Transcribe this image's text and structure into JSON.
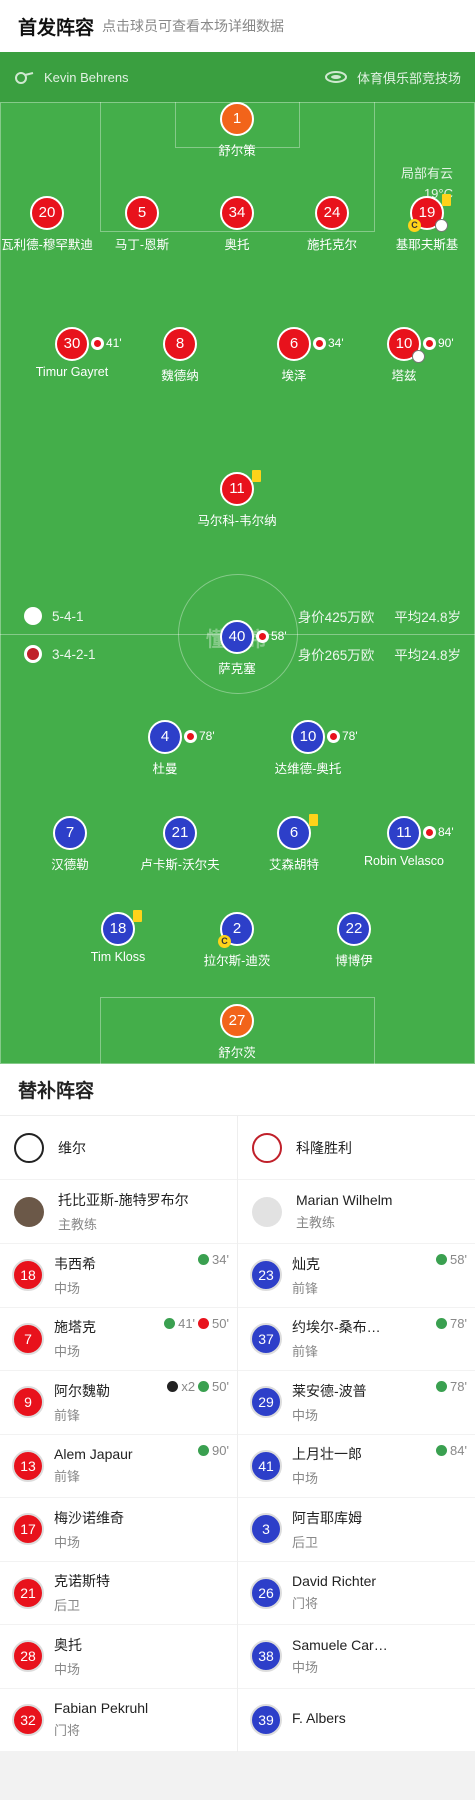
{
  "header": {
    "title": "首发阵容",
    "hint": "点击球员可查看本场详细数据"
  },
  "match": {
    "referee": "Kevin Behrens",
    "venue": "体育俱乐部竞技场",
    "weather": "局部有云",
    "temperature": "19°C",
    "watermark": "懂球帝"
  },
  "home_team": {
    "formation": "5-4-1",
    "value": "身价425万欧",
    "age": "平均24.8岁"
  },
  "away_team": {
    "formation": "3-4-2-1",
    "value": "身价265万欧",
    "age": "平均24.8岁"
  },
  "home_players": [
    {
      "num": "1",
      "name": "舒尔策",
      "gk": true
    },
    {
      "num": "20",
      "name": "瓦利德-穆罕默迪"
    },
    {
      "num": "5",
      "name": "马丁-恩斯"
    },
    {
      "num": "34",
      "name": "奥托"
    },
    {
      "num": "24",
      "name": "施托克尔"
    },
    {
      "num": "19",
      "name": "基耶夫斯基",
      "yellow": true,
      "captain": true,
      "goal": true
    },
    {
      "num": "30",
      "name": "Timur Gayret",
      "sub": "41'"
    },
    {
      "num": "8",
      "name": "魏德纳"
    },
    {
      "num": "6",
      "name": "埃泽",
      "sub": "34'"
    },
    {
      "num": "10",
      "name": "塔兹",
      "sub": "90'",
      "goal": true
    },
    {
      "num": "11",
      "name": "马尔科-韦尔纳",
      "yellow": true
    }
  ],
  "away_players": [
    {
      "num": "40",
      "name": "萨克塞",
      "sub": "58'"
    },
    {
      "num": "4",
      "name": "杜曼",
      "sub": "78'"
    },
    {
      "num": "10",
      "name": "达维德-奥托",
      "sub": "78'"
    },
    {
      "num": "7",
      "name": "汉德勒"
    },
    {
      "num": "21",
      "name": "卢卡斯-沃尔夫"
    },
    {
      "num": "6",
      "name": "艾森胡特",
      "yellow": true
    },
    {
      "num": "11",
      "name": "Robin Velasco",
      "sub": "84'"
    },
    {
      "num": "18",
      "name": "Tim Kloss",
      "yellow": true
    },
    {
      "num": "2",
      "name": "拉尔斯-迪茨",
      "captain": true
    },
    {
      "num": "22",
      "name": "博博伊"
    },
    {
      "num": "27",
      "name": "舒尔茨",
      "gk": true
    }
  ],
  "subs": {
    "title": "替补阵容",
    "home": {
      "team_name": "维尔",
      "coach_name": "托比亚斯-施特罗布尔",
      "coach_role": "主教练",
      "players": [
        {
          "num": "18",
          "name": "韦西希",
          "pos": "中场",
          "ev": "34'"
        },
        {
          "num": "7",
          "name": "施塔克",
          "pos": "中场",
          "ev": "41'",
          "ev2": "50'"
        },
        {
          "num": "9",
          "name": "阿尔魏勒",
          "pos": "前锋",
          "ev": "x2",
          "ev2": "50'"
        },
        {
          "num": "13",
          "name": "Alem Japaur",
          "pos": "前锋",
          "ev": "90'"
        },
        {
          "num": "17",
          "name": "梅沙诺维奇",
          "pos": "中场"
        },
        {
          "num": "21",
          "name": "克诺斯特",
          "pos": "后卫"
        },
        {
          "num": "28",
          "name": "奥托",
          "pos": "中场"
        },
        {
          "num": "32",
          "name": "Fabian Pekruhl",
          "pos": "门将"
        }
      ]
    },
    "away": {
      "team_name": "科隆胜利",
      "coach_name": "Marian Wilhelm",
      "coach_role": "主教练",
      "players": [
        {
          "num": "23",
          "name": "灿克",
          "pos": "前锋",
          "ev": "58'"
        },
        {
          "num": "37",
          "name": "约埃尔-桑布…",
          "pos": "前锋",
          "ev": "78'"
        },
        {
          "num": "29",
          "name": "莱安德-波普",
          "pos": "中场",
          "ev": "78'"
        },
        {
          "num": "41",
          "name": "上月壮一郎",
          "pos": "中场",
          "ev": "84'"
        },
        {
          "num": "3",
          "name": "阿吉耶库姆",
          "pos": "后卫"
        },
        {
          "num": "26",
          "name": "David Richter",
          "pos": "门将"
        },
        {
          "num": "38",
          "name": "Samuele Car…",
          "pos": "中场"
        },
        {
          "num": "39",
          "name": "F. Albers",
          "pos": ""
        }
      ]
    }
  }
}
